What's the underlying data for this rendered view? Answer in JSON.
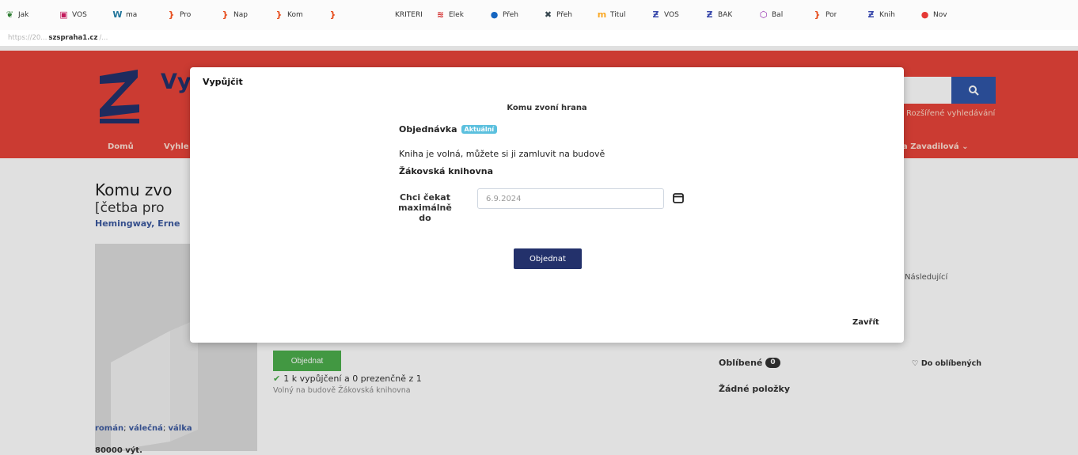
{
  "bookmarks": [
    {
      "label": "Jak",
      "icon": "leaf-icon",
      "color": "#2e7d32",
      "glyph": "❦"
    },
    {
      "label": "VOŠ",
      "icon": "square-logo-icon",
      "color": "#c2185b",
      "glyph": "▣"
    },
    {
      "label": "ma",
      "icon": "wordpress-icon",
      "color": "#21759b",
      "glyph": "W"
    },
    {
      "label": "Pro",
      "icon": "bracket-icon",
      "color": "#e64a19",
      "glyph": "}"
    },
    {
      "label": "Nap",
      "icon": "bracket-icon",
      "color": "#e64a19",
      "glyph": "}"
    },
    {
      "label": "Kom",
      "icon": "bracket-icon",
      "color": "#e64a19",
      "glyph": "}"
    },
    {
      "label": "",
      "icon": "bracket-icon",
      "color": "#e64a19",
      "glyph": "}"
    },
    {
      "label": "KRITERI",
      "icon": "",
      "color": "#333333",
      "glyph": ""
    },
    {
      "label": "Elek",
      "icon": "flag-icon",
      "color": "#d32f2f",
      "glyph": "≋"
    },
    {
      "label": "Přeh",
      "icon": "globe-icon",
      "color": "#1565c0",
      "glyph": "●"
    },
    {
      "label": "Přeh",
      "icon": "grid-icon",
      "color": "#37474f",
      "glyph": "✖"
    },
    {
      "label": "Titul",
      "icon": "th-icon",
      "color": "#f9a825",
      "glyph": "m"
    },
    {
      "label": "VOŠ",
      "icon": "z-logo-icon",
      "color": "#3949ab",
      "glyph": "Ƶ"
    },
    {
      "label": "BAK",
      "icon": "z-logo-icon",
      "color": "#3949ab",
      "glyph": "Ƶ"
    },
    {
      "label": "Bal",
      "icon": "hexagon-icon",
      "color": "#8e24aa",
      "glyph": "⬡"
    },
    {
      "label": "Por",
      "icon": "bracket-icon",
      "color": "#e64a19",
      "glyph": "}"
    },
    {
      "label": "Knih",
      "icon": "z-logo-icon",
      "color": "#3949ab",
      "glyph": "Ƶ"
    },
    {
      "label": "Nov",
      "icon": "circle-icon",
      "color": "#e53935",
      "glyph": "●"
    }
  ],
  "url": {
    "prefix": "https://20...",
    "domain": "szspraha1.cz",
    "rest": "/..."
  },
  "page": {
    "site_title": "Vy",
    "advanced_search": "Rozšířené vyhledávání",
    "nav_home": "Domů",
    "nav_search": "Vyhle",
    "user_menu": "a Zavadilová ⌄",
    "book_title": "Komu zvo",
    "book_subtitle": "[četba pro",
    "author": "Hemingway, Erne",
    "next_label": "Následující",
    "order_button": "Objednat",
    "availability": "1 k vypůjčení a 0 prezenčně z 1",
    "availability_location": "Volný na budově Žákovská knihovna",
    "favorites_label": "Oblíbené",
    "favorites_count": "0",
    "add_favorite": "♡ Do oblíbených",
    "no_items": "Žádné položky",
    "tag1": "román",
    "tag2": "válečná",
    "tag3": "válka",
    "tag_sep": "; ",
    "barcode": "80000 výt."
  },
  "modal": {
    "title": "Vypůjčit",
    "heading": "Komu zvoní hrana",
    "order_label": "Objednávka",
    "badge": "Aktuální",
    "free_text": "Kniha je volná, můžete si ji zamluvit na budově",
    "library": "Žákovská knihovna",
    "wait_label": "Chci čekat maximálně do",
    "date_value": "6.9.2024",
    "submit": "Objednat",
    "close": "Zavřít"
  },
  "colors": {
    "header": "#e8443a",
    "brand_blue": "#23316b",
    "search_button": "#2f56a8",
    "order_green": "#4cae4c",
    "badge": "#5bc0de"
  }
}
